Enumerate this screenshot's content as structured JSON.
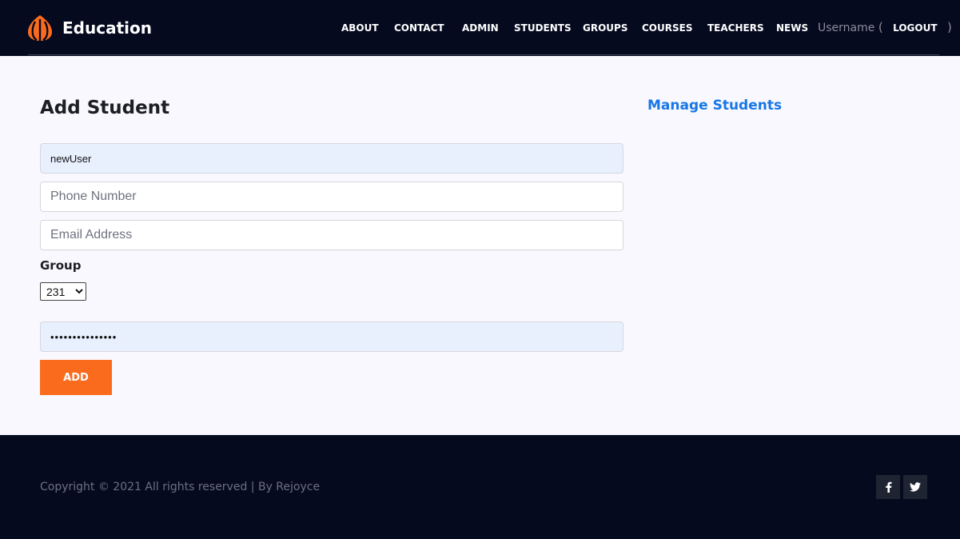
{
  "header": {
    "brand_name": "Education",
    "nav": {
      "about": "ABOUT",
      "contact": "CONTACT",
      "admin": "ADMIN",
      "students": "STUDENTS",
      "groups": "GROUPS",
      "courses": "COURSES",
      "teachers": "TEACHERS",
      "news": "NEWS"
    },
    "user": {
      "username": "Username",
      "open_paren": "(",
      "logout": "LOGOUT",
      "close_paren": ")"
    }
  },
  "main": {
    "title": "Add Student",
    "manage_link": "Manage Students",
    "form": {
      "username_value": "newUser",
      "phone_placeholder": "Phone Number",
      "email_placeholder": "Email Address",
      "group_label": "Group",
      "group_selected": "231",
      "password_value": "•••••••••••••••",
      "add_button": "ADD"
    }
  },
  "footer": {
    "copyright": "Copyright © 2021 All rights reserved | By Rejoyce",
    "social": [
      "facebook-icon",
      "twitter-icon"
    ]
  },
  "colors": {
    "header_bg": "#050a1f",
    "accent_orange": "#fb6b1d",
    "link_blue": "#1877e6",
    "page_bg": "#f8f8fe"
  }
}
